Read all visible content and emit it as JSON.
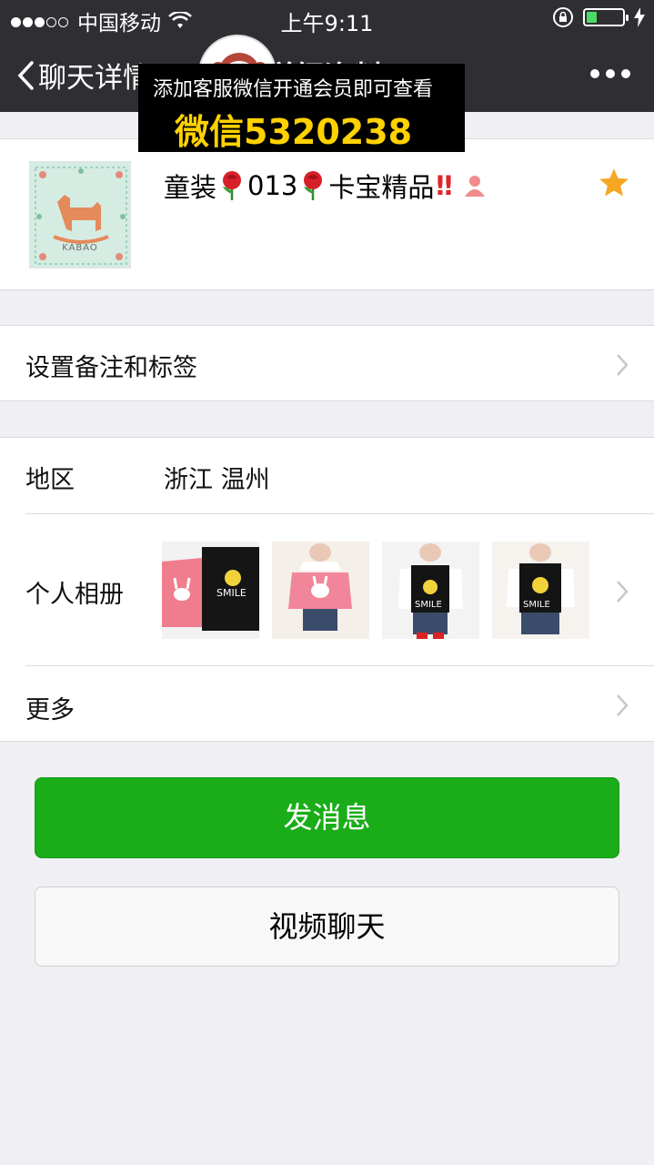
{
  "status_bar": {
    "carrier": "中国移动",
    "time": "上午9:11",
    "battery_level": 0.3
  },
  "nav": {
    "back_label": "聊天详情",
    "title": "详细资料"
  },
  "profile": {
    "avatar_brand": "KABAO",
    "nickname_part1": "童装",
    "nickname_part2": "013",
    "nickname_part3": "卡宝精品",
    "nickname_bang": "‼",
    "starred": true
  },
  "overlay_ad": {
    "line1": "添加客服微信开通会员即可查看",
    "line2": "微信5320238"
  },
  "remark_row": {
    "label": "设置备注和标签"
  },
  "region_row": {
    "label": "地区",
    "value": "浙江 温州"
  },
  "album_row": {
    "label": "个人相册",
    "thumbnails": [
      "pink-bunny-and-smile-sweaters",
      "pink-bunny-sweater-outfit",
      "black-smile-vest-outfit",
      "black-smile-vest-outfit-2"
    ]
  },
  "more_row": {
    "label": "更多"
  },
  "buttons": {
    "send_message": "发消息",
    "video_chat": "视频聊天"
  },
  "colors": {
    "navbar": "#2e2e33",
    "primary_green": "#1aad19",
    "overlay_text": "#ffd200",
    "star": "#f5a623",
    "battery": "#4cd964"
  }
}
